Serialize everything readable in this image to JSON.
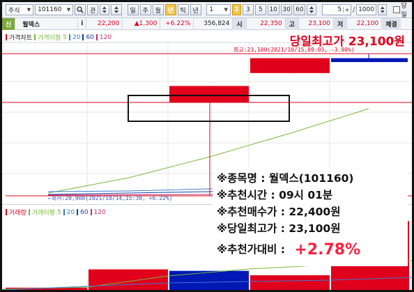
{
  "toolbar": {
    "market": "주식",
    "code": "101160",
    "search_icon": "search-icon",
    "bookmark_label": "관",
    "periods": [
      "일",
      "주",
      "월",
      "년",
      "틱",
      "년"
    ],
    "selected_period": "년",
    "interval_value": "1",
    "minute_options": [
      "3",
      "5",
      "10",
      "30",
      "60"
    ],
    "highlight_label": "1",
    "count_value": "5",
    "bars_value": "1000",
    "checkbox_label": "당일"
  },
  "quote": {
    "prefix": "신",
    "name": "월덱스",
    "info_icon": "i",
    "price": "22,200",
    "change": "▲1,300",
    "rate": "+6.22%",
    "volume": "356,824",
    "open_label": "시",
    "open": "22,350",
    "high_label": "고",
    "high": "23,100",
    "low_label": "저",
    "low": "22,100",
    "last_label": "체결"
  },
  "price_chart": {
    "legend": [
      "가격차트",
      "가격이평",
      "5",
      "20",
      "60",
      "120"
    ],
    "max_annotation": "최고:23,100(2021/10/15,09:03, -3.90%)",
    "min_annotation": "←최저:20,900(2021/10/14,15:30, +6.22%)",
    "headline": "당일최고가 23,100원"
  },
  "volume_chart": {
    "legend": [
      "거래량",
      "거래이평",
      "5",
      "20",
      "60",
      "120"
    ]
  },
  "info_box": {
    "stock_label": "※종목명 : ",
    "stock_value": "월덱스(101160)",
    "time_label": "※추천시간 : ",
    "time_value": "09시 01분",
    "buy_label": "※추천매수가 : ",
    "buy_value": "22,400원",
    "high_label": "※당일최고가 : ",
    "high_value": "23,100원",
    "rate_label": "※추천가대비 : ",
    "rate_value": "+2.78%"
  },
  "colors": {
    "up": "#e0001b",
    "down": "#0018b4",
    "ma5": "#78b83a",
    "ma20": "#3a7bd5",
    "ma60": "#1a3da0",
    "ma120": "#c0306a"
  },
  "candles": [
    {
      "open": 22350,
      "close": 22600,
      "high": 22600,
      "low": 20900
    },
    {
      "open": 22800,
      "close": 23030,
      "high": 23030,
      "low": 22800
    },
    {
      "open": 23030,
      "close": 22970,
      "high": 23100,
      "low": 22970
    }
  ],
  "volumes": [
    {
      "value": 100,
      "dir": "up"
    },
    {
      "value": 29,
      "dir": "up"
    },
    {
      "value": 27,
      "dir": "down"
    },
    {
      "value": 21,
      "dir": "up"
    },
    {
      "value": 95,
      "dir": "up"
    }
  ]
}
